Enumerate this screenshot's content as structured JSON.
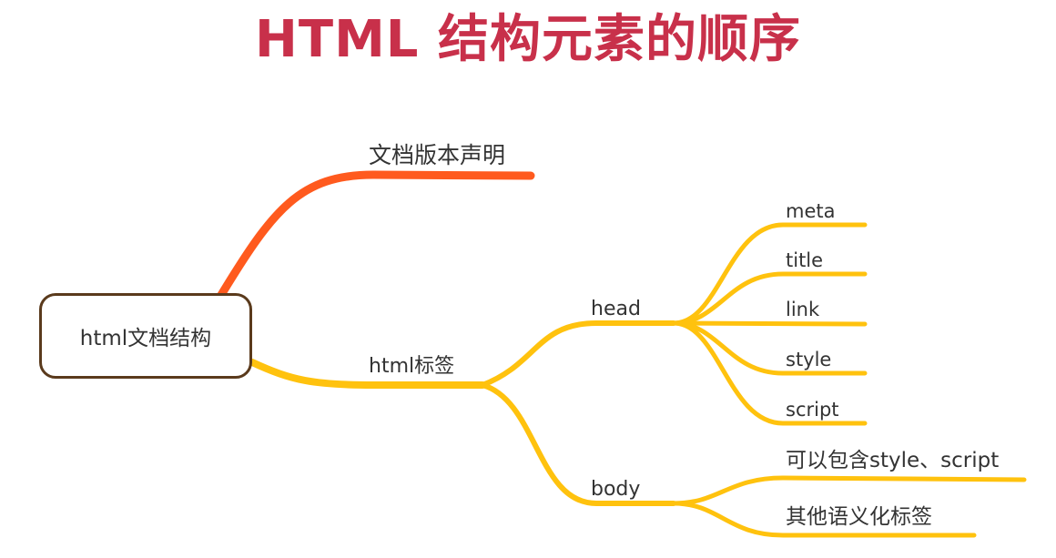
{
  "title": "HTML 结构元素的顺序",
  "root": "html文档结构",
  "branches": {
    "doctype": "文档版本声明",
    "html_tag": "html标签",
    "head": "head",
    "body": "body"
  },
  "head_children": [
    "meta",
    "title",
    "link",
    "style",
    "script"
  ],
  "body_children": [
    "可以包含style、script",
    "其他语义化标签"
  ],
  "colors": {
    "title": "#c8304a",
    "doctype_branch": "#ff5a1e",
    "html_branch": "#ffc20e",
    "root_border": "#5a3a1c"
  }
}
